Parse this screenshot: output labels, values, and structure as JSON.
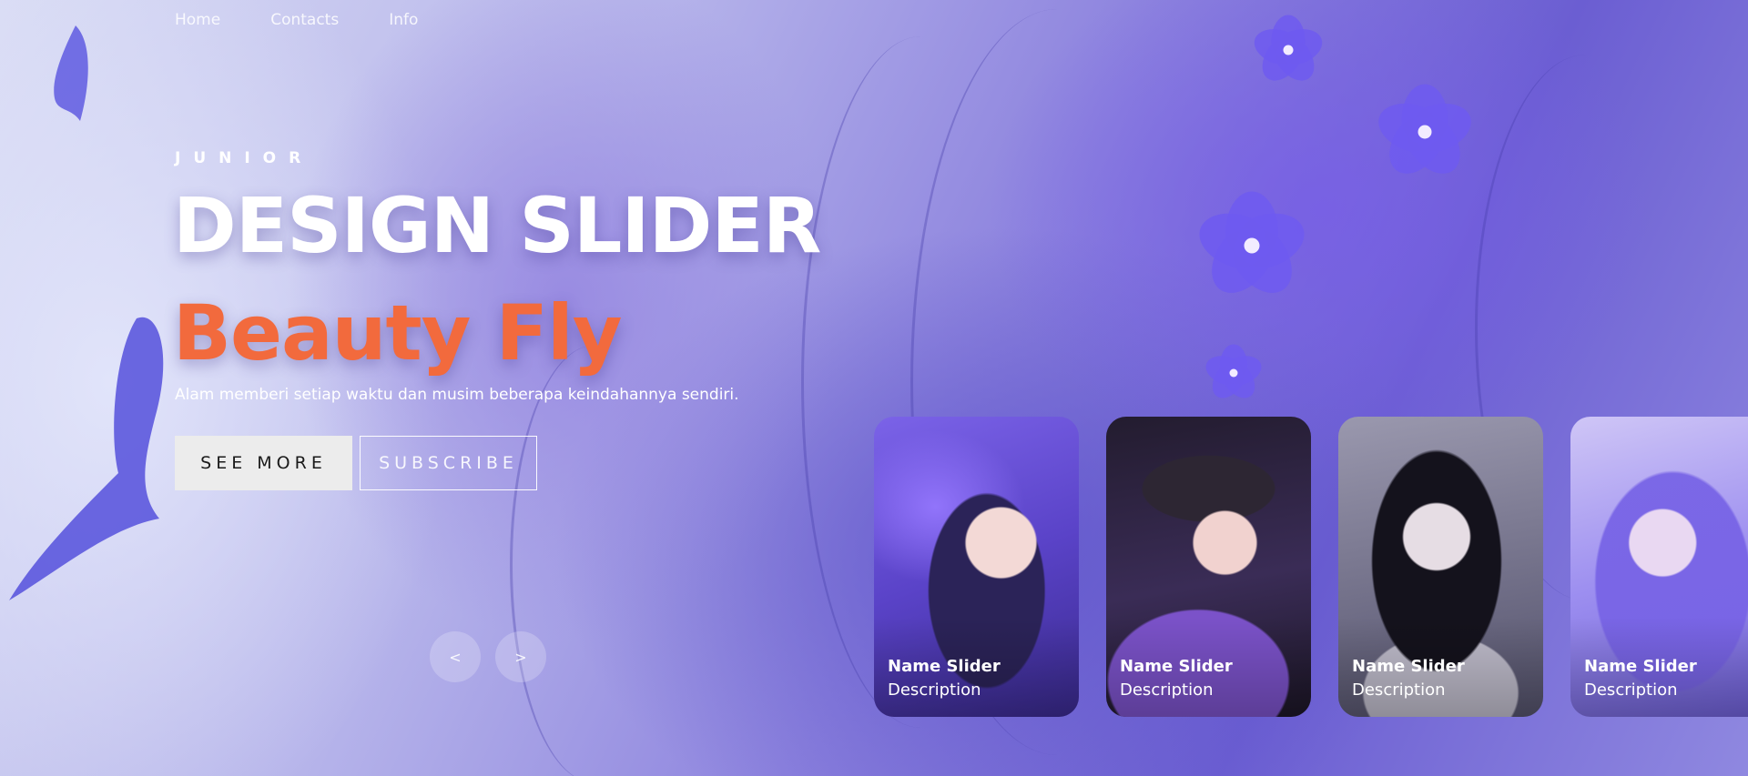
{
  "nav": {
    "items": [
      {
        "label": "Home"
      },
      {
        "label": "Contacts"
      },
      {
        "label": "Info"
      }
    ]
  },
  "hero": {
    "eyebrow": "JUNIOR",
    "title": "DESIGN SLIDER",
    "topic": "Beauty Fly",
    "description": "Alam memberi setiap waktu dan musim beberapa keindahannya sendiri.",
    "buttons": {
      "see_more": "SEE MORE",
      "subscribe": "SUBSCRIBE"
    }
  },
  "arrows": {
    "prev": "<",
    "next": ">"
  },
  "thumbnails": [
    {
      "name": "Name Slider",
      "description": "Description"
    },
    {
      "name": "Name Slider",
      "description": "Description"
    },
    {
      "name": "Name Slider",
      "description": "Description"
    },
    {
      "name": "Name Slider",
      "description": "Description"
    }
  ],
  "colors": {
    "topic_accent": "#f26a3d",
    "see_more_bg": "#ececec",
    "text": "#ffffff"
  }
}
